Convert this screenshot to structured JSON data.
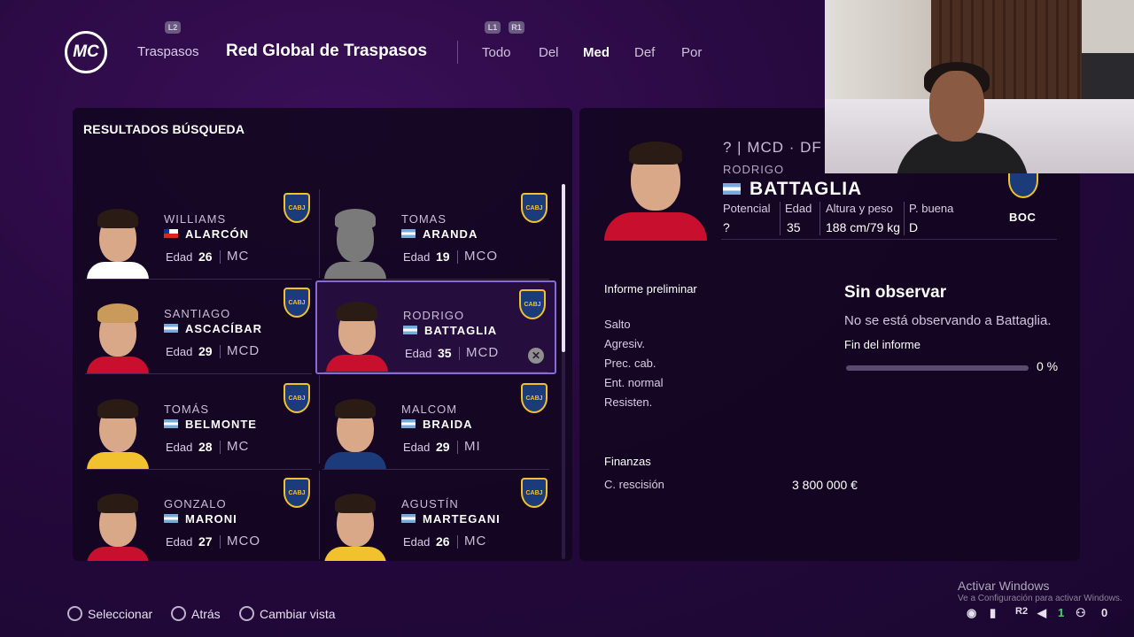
{
  "header": {
    "logo_text": "MC",
    "l2": "L2",
    "l1": "L1",
    "r1": "R1",
    "section": "Traspasos",
    "title": "Red Global de Traspasos",
    "categories": [
      "Todo",
      "Del",
      "Med",
      "Def",
      "Por"
    ],
    "active_category": "Med"
  },
  "results": {
    "title": "RESULTADOS BÚSQUEDA",
    "age_label": "Edad",
    "players": [
      {
        "first": "WILLIAMS",
        "last": "ALARCÓN",
        "nation": "chi",
        "age": "26",
        "pos": "MC",
        "club": "CABJ"
      },
      {
        "first": "TOMAS",
        "last": "ARANDA",
        "nation": "arg",
        "age": "19",
        "pos": "MCO",
        "club": "CABJ"
      },
      {
        "first": "SANTIAGO",
        "last": "ASCACÍBAR",
        "nation": "arg",
        "age": "29",
        "pos": "MCD",
        "club": "CABJ"
      },
      {
        "first": "RODRIGO",
        "last": "BATTAGLIA",
        "nation": "arg",
        "age": "35",
        "pos": "MCD",
        "club": "CABJ"
      },
      {
        "first": "TOMÁS",
        "last": "BELMONTE",
        "nation": "arg",
        "age": "28",
        "pos": "MC",
        "club": "CABJ"
      },
      {
        "first": "MALCOM",
        "last": "BRAIDA",
        "nation": "arg",
        "age": "29",
        "pos": "MI",
        "club": "CABJ"
      },
      {
        "first": "GONZALO",
        "last": "MARONI",
        "nation": "arg",
        "age": "27",
        "pos": "MCO",
        "club": "CABJ"
      },
      {
        "first": "AGUSTÍN",
        "last": "MARTEGANI",
        "nation": "arg",
        "age": "26",
        "pos": "MC",
        "club": "CABJ"
      }
    ]
  },
  "detail": {
    "top_line": "?  |  MCD · DF",
    "first": "RODRIGO",
    "last": "BATTAGLIA",
    "attrs": [
      {
        "label": "Potencial",
        "value": "?"
      },
      {
        "label": "Edad",
        "value": "35"
      },
      {
        "label": "Altura y peso",
        "value": "188 cm/79 kg"
      },
      {
        "label": "P. buena",
        "value": "D"
      }
    ],
    "club": "BOC",
    "report_title": "Informe preliminar",
    "stats": [
      "Salto",
      "Agresiv.",
      "Prec. cab.",
      "Ent. normal",
      "Resisten."
    ],
    "observe_title": "Sin observar",
    "observe_desc": "No se está observando a Battaglia.",
    "report_end": "Fin del informe",
    "progress": 0,
    "progress_label": "0 %",
    "finance_title": "Finanzas",
    "clause_label": "C. rescisión",
    "clause_value": "3 800 000 €"
  },
  "footer": {
    "select": "Seleccionar",
    "back": "Atrás",
    "change_view": "Cambiar vista",
    "win_activate": "Activar Windows",
    "win_sub": "Ve a Configuración para activar Windows.",
    "r2": "R2",
    "count_a": "1",
    "count_b": "0"
  }
}
